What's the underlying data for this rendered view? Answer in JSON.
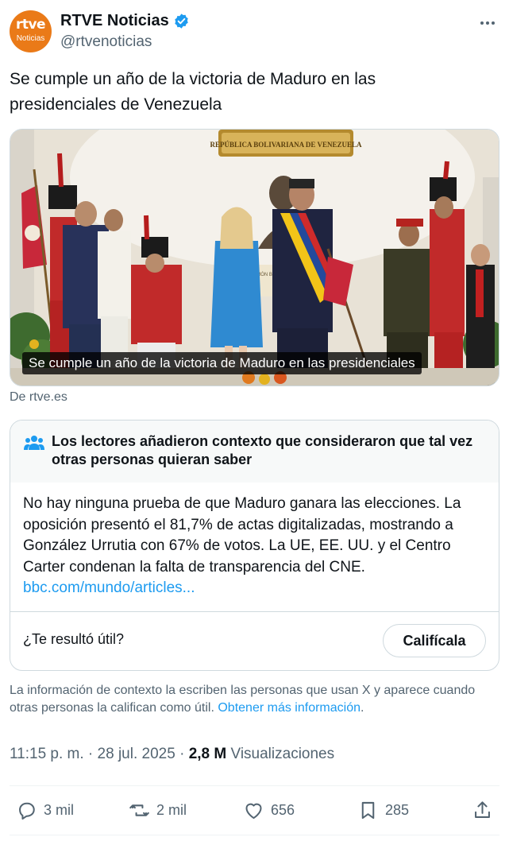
{
  "account": {
    "avatar_line1": "rtve",
    "avatar_line2": "Noticias",
    "display_name": "RTVE Noticias",
    "handle": "@rtvenoticias"
  },
  "tweet": {
    "text": "Se cumple un año de la victoria de Maduro en las presidenciales de Venezuela"
  },
  "media": {
    "caption": "Se cumple un año de la victoria de Maduro en las presidenciales",
    "banner_text": "REPÚBLICA BOLIVARIANA DE VENEZUELA",
    "plaque_text": "SIMÓN BOLÍVAR",
    "source": "De rtve.es"
  },
  "community_note": {
    "title": "Los lectores añadieron contexto que consideraron que tal vez otras personas quieran saber",
    "body": "No hay ninguna prueba de que Maduro ganara las elecciones. La oposición presentó el 81,7% de actas digitalizadas, mostrando a González Urrutia con 67% de votos. La UE, EE. UU. y el Centro Carter condenan la falta de transparencia del CNE.",
    "link": "bbc.com/mundo/articles...",
    "question": "¿Te resultó útil?",
    "rate_label": "Califícala"
  },
  "context_info": {
    "text": "La información de contexto la escriben las personas que usan X y aparece cuando otras personas la califican como útil.",
    "link": "Obtener más información",
    "end": "."
  },
  "meta": {
    "time": "11:15 p. m.",
    "sep1": " · ",
    "date": "28 jul. 2025",
    "sep2": " · ",
    "views_count": "2,8 M",
    "views_label": " Visualizaciones"
  },
  "actions": {
    "replies": "3 mil",
    "reposts": "2 mil",
    "likes": "656",
    "bookmarks": "285"
  },
  "colors": {
    "accent": "#1d9bf0",
    "secondary_text": "#536471",
    "brand_orange": "#ea7a18"
  }
}
